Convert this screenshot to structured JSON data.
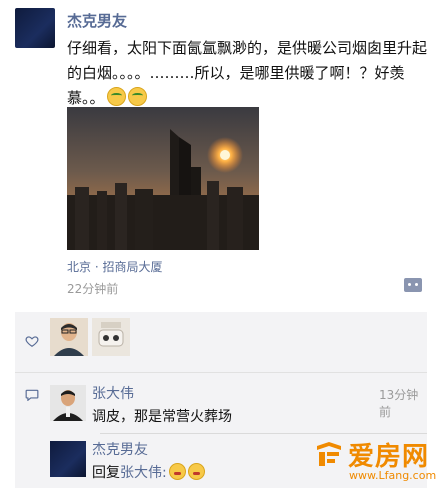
{
  "post": {
    "author": "杰克男友",
    "text": "仔细看，太阳下面氤氲飘渺的，是供暖公司烟囱里升起的白烟。。。。………所以，是哪里供暖了啊！？好羡慕。。",
    "location": "北京 · 招商局大厦",
    "time": "22分钟前"
  },
  "comments": [
    {
      "author": "张大伟",
      "time": "13分钟前",
      "text": "调皮，那是常营火葬场"
    },
    {
      "author": "杰克男友",
      "reply_prefix": "回复",
      "reply_to": "张大伟:"
    }
  ],
  "watermark": {
    "brand": "爱房网",
    "url": "www.Lfang.com"
  },
  "colors": {
    "link": "#576b95",
    "meta": "#9a9a9a",
    "comment_bg": "#f3f3f5",
    "watermark": "#f08a00"
  }
}
